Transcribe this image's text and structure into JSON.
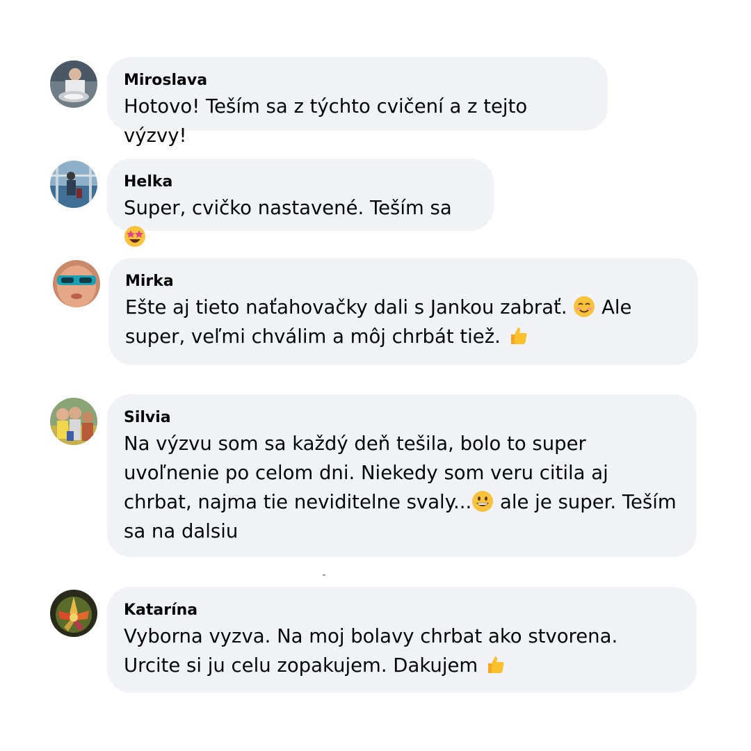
{
  "comments": [
    {
      "author": "Miroslava",
      "text": "Hotovo! Teším sa z týchto cvičení a z tejto výzvy!"
    },
    {
      "author": "Helka",
      "text": "Super, cvičko nastavené. Teším sa",
      "emoji": "star-struck-emoji"
    },
    {
      "author": "Mirka",
      "line1_a": "Ešte aj tieto naťahovačky dali s Jankou zabrať.",
      "line1_emoji": "smiling-face-emoji",
      "line1_b": "Ale",
      "line2_a": "super, veľmi chválim a môj chrbát tiež.",
      "line2_emoji": "thumbs-up-emoji"
    },
    {
      "author": "Silvia",
      "line1": "Na výzvu som sa každý deň tešila, bolo to super",
      "line2": "uvoľnenie po celom dni. Niekedy som veru citila aj",
      "line3_a": "chrbat, najma tie neviditelne svaly...",
      "line3_emoji": "grinning-face-emoji",
      "line3_b": "ale je super. Teším",
      "line4": "sa na dalsiu"
    },
    {
      "author": "Katarína",
      "line1": "Vyborna vyzva. Na moj bolavy chrbat ako stvorena.",
      "line2": "Urcite si ju celu zopakujem. Dakujem",
      "line2_emoji": "thumbs-up-emoji"
    }
  ],
  "colors": {
    "bubble": "#f0f2f5",
    "text": "#050505",
    "background": "#ffffff"
  }
}
